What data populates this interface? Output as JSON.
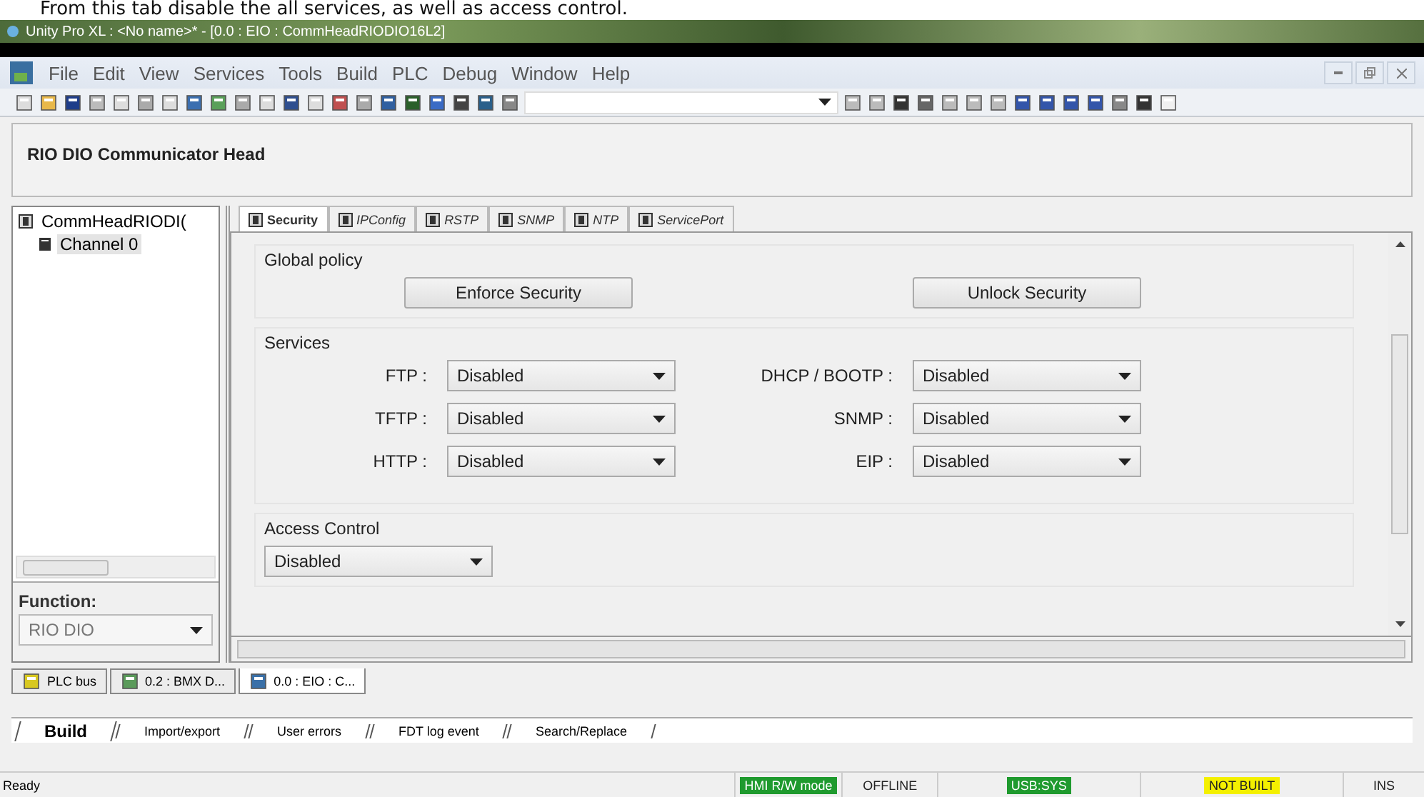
{
  "caption": "From this tab disable the all services, as well as access control.",
  "window": {
    "title": "Unity Pro XL : <No name>* - [0.0 : EIO : CommHeadRIODIO16L2]"
  },
  "menu": [
    "File",
    "Edit",
    "View",
    "Services",
    "Tools",
    "Build",
    "PLC",
    "Debug",
    "Window",
    "Help"
  ],
  "header": {
    "title": "RIO DIO Communicator Head"
  },
  "tree": {
    "label": "CommHeadRIODI(",
    "children": [
      {
        "label": "Channel 0",
        "selected": true
      }
    ]
  },
  "function": {
    "label": "Function:",
    "value": "RIO DIO"
  },
  "tabs": [
    {
      "label": "Security",
      "selected": true
    },
    {
      "label": "IPConfig",
      "selected": false
    },
    {
      "label": "RSTP",
      "selected": false
    },
    {
      "label": "SNMP",
      "selected": false
    },
    {
      "label": "NTP",
      "selected": false
    },
    {
      "label": "ServicePort",
      "selected": false
    }
  ],
  "global_policy": {
    "title": "Global policy",
    "buttons": [
      "Enforce Security",
      "Unlock Security"
    ]
  },
  "services": {
    "title": "Services",
    "items": [
      {
        "label": "FTP :",
        "value": "Disabled"
      },
      {
        "label": "DHCP / BOOTP :",
        "value": "Disabled"
      },
      {
        "label": "TFTP :",
        "value": "Disabled"
      },
      {
        "label": "SNMP :",
        "value": "Disabled"
      },
      {
        "label": "HTTP :",
        "value": "Disabled"
      },
      {
        "label": "EIP :",
        "value": "Disabled"
      }
    ]
  },
  "access_control": {
    "title": "Access Control",
    "value": "Disabled"
  },
  "doc_tabs": [
    {
      "label": "PLC bus",
      "selected": false
    },
    {
      "label": "0.2 : BMX D...",
      "selected": false
    },
    {
      "label": "0.0 : EIO : C...",
      "selected": true
    }
  ],
  "output_tabs": [
    {
      "label": "Build",
      "selected": true
    },
    {
      "label": "Import/export",
      "selected": false
    },
    {
      "label": "User errors",
      "selected": false
    },
    {
      "label": "FDT log event",
      "selected": false
    },
    {
      "label": "Search/Replace",
      "selected": false
    }
  ],
  "status_bar": {
    "message": "Ready",
    "fields": [
      {
        "text": "HMI R/W mode",
        "color": "#1f9a2e"
      },
      {
        "text": "OFFLINE"
      },
      {
        "text": "USB:SYS",
        "color": "#1f9a2e"
      },
      {
        "text": "NOT BUILT",
        "color": "#f4f000"
      },
      {
        "text": "INS"
      }
    ]
  }
}
